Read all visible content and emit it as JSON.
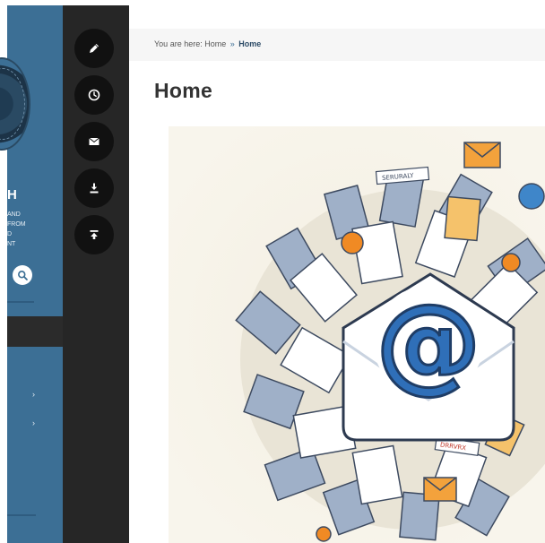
{
  "sidebar": {
    "site_initial": "H",
    "tagline": "AND\nFROM\nD\nNT",
    "search_icon": "search-icon",
    "menu_icon": "chevron-right-icon",
    "menu_chevron": "›"
  },
  "tools": [
    {
      "icon": "pencil-icon"
    },
    {
      "icon": "clock-icon"
    },
    {
      "icon": "envelope-icon"
    },
    {
      "icon": "download-icon"
    },
    {
      "icon": "scroll-to-top-icon"
    }
  ],
  "breadcrumb": {
    "prefix": "You are here: ",
    "home": "Home",
    "separator": "»",
    "current": "Home"
  },
  "page": {
    "title": "Home"
  },
  "hero": {
    "description": "illustration of email symbol surrounded by documents",
    "labels": [
      "SERURALY",
      "DRRVRX"
    ]
  },
  "colors": {
    "sidebar_blue": "#3c6f95",
    "tool_dark": "#262626",
    "tool_button": "#111111",
    "breadcrumb_current": "#2b4a66"
  }
}
